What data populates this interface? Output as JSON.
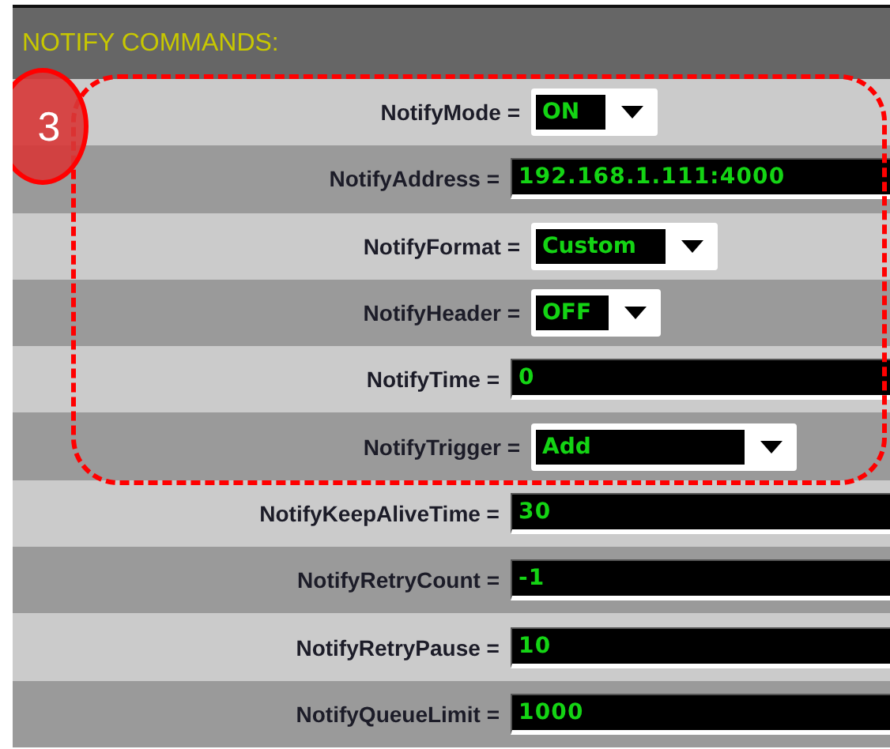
{
  "section": {
    "title": "NOTIFY COMMANDS:"
  },
  "callout": {
    "number": "3",
    "rows": [
      {
        "label": "NotifyMode =",
        "kind": "select",
        "value": "ON"
      },
      {
        "label": "NotifyAddress =",
        "kind": "input",
        "value": "192.168.1.111:4000"
      },
      {
        "label": "NotifyFormat =",
        "kind": "select",
        "value": "Custom"
      },
      {
        "label": "NotifyHeader =",
        "kind": "select",
        "value": "OFF"
      },
      {
        "label": "NotifyTime =",
        "kind": "input",
        "value": "0"
      },
      {
        "label": "NotifyTrigger =",
        "kind": "select",
        "value": "Add"
      }
    ]
  },
  "rows": [
    {
      "label": "NotifyKeepAliveTime =",
      "kind": "input",
      "value": "30"
    },
    {
      "label": "NotifyRetryCount =",
      "kind": "input",
      "value": "-1"
    },
    {
      "label": "NotifyRetryPause =",
      "kind": "input",
      "value": "10"
    },
    {
      "label": "NotifyQueueLimit =",
      "kind": "input",
      "value": "1000"
    }
  ]
}
